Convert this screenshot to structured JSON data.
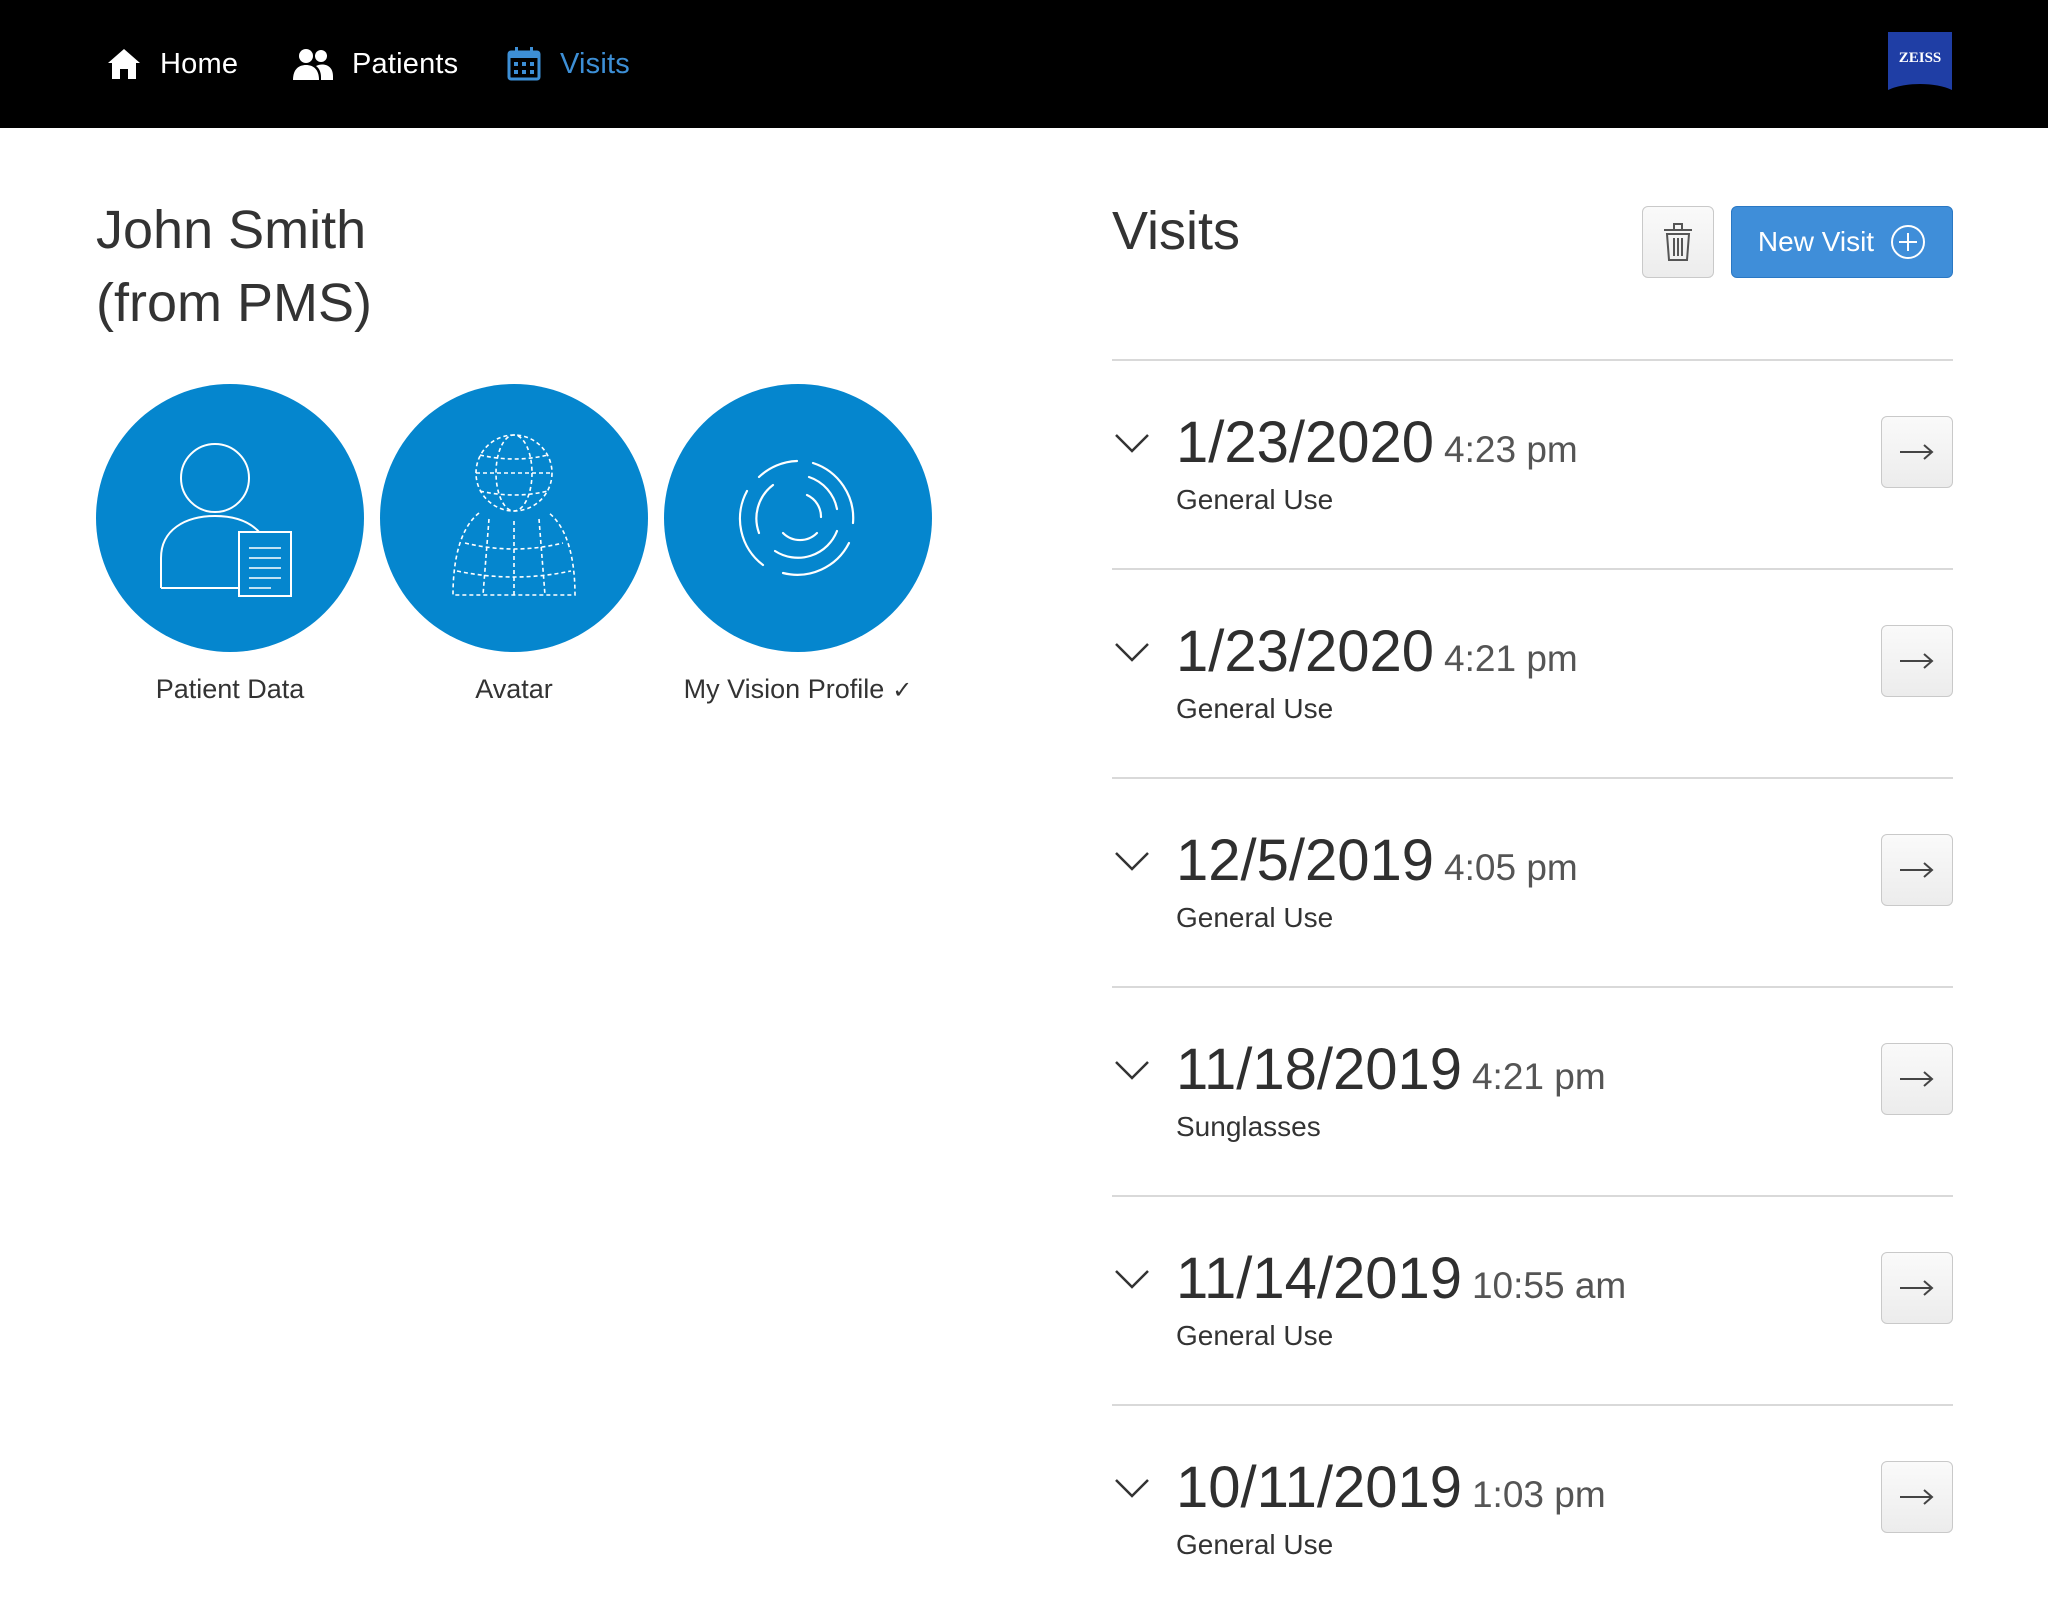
{
  "nav": {
    "home_label": "Home",
    "patients_label": "Patients",
    "visits_label": "Visits",
    "active_item": "visits",
    "active_color": "#3d8fd6"
  },
  "brand": {
    "logo_text": "ZEISS",
    "logo_color": "#1f3ea5"
  },
  "patient": {
    "name_line1": "John Smith",
    "name_line2": "(from PMS)",
    "tiles": [
      {
        "label": "Patient Data",
        "icon": "patient-data-icon"
      },
      {
        "label": "Avatar",
        "icon": "avatar-icon"
      },
      {
        "label": "My Vision Profile",
        "icon": "vision-profile-icon",
        "check": "✓"
      }
    ],
    "tile_color": "#0586ce"
  },
  "visits": {
    "title": "Visits",
    "new_visit_label": "New Visit",
    "items": [
      {
        "date": "1/23/2020",
        "time": "4:23 pm",
        "type": "General Use"
      },
      {
        "date": "1/23/2020",
        "time": "4:21 pm",
        "type": "General Use"
      },
      {
        "date": "12/5/2019",
        "time": "4:05 pm",
        "type": "General Use"
      },
      {
        "date": "11/18/2019",
        "time": "4:21 pm",
        "type": "Sunglasses"
      },
      {
        "date": "11/14/2019",
        "time": "10:55 am",
        "type": "General Use"
      },
      {
        "date": "10/11/2019",
        "time": "1:03 pm",
        "type": "General Use"
      }
    ]
  }
}
